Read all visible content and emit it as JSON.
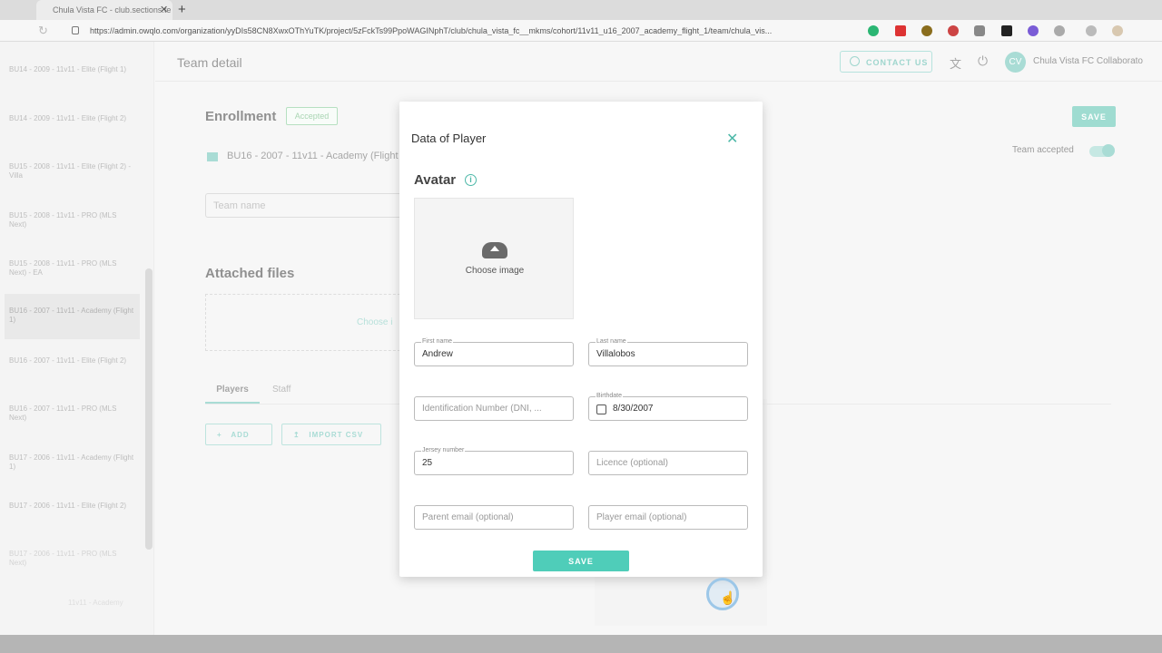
{
  "browser": {
    "tab_title": "Chula Vista FC - club.sections.te",
    "tab_close": "✕",
    "tab_new": "+",
    "url": "https://admin.owqlo.com/organization/yyDIs58CN8XwxOThYuTK/project/5zFckTs99PpoWAGINphT/club/chula_vista_fc__mkms/cohort/11v11_u16_2007_academy_flight_1/team/chula_vis..."
  },
  "sidebar": {
    "items": [
      {
        "label": "BU14 - 2009 - 11v11 - Elite (Flight 1)"
      },
      {
        "label": "BU14 - 2009 - 11v11 - Elite (Flight 2)"
      },
      {
        "label": "BU15 - 2008 - 11v11 - Elite (Flight 2) - Villa"
      },
      {
        "label": "BU15 - 2008 - 11v11 - PRO (MLS Next)"
      },
      {
        "label": "BU15 - 2008 - 11v11 - PRO (MLS Next) - EA"
      },
      {
        "label": "BU16 - 2007 - 11v11 - Academy (Flight 1)"
      },
      {
        "label": "BU16 - 2007 - 11v11 - Elite (Flight 2)"
      },
      {
        "label": "BU16 - 2007 - 11v11 - PRO (MLS Next)"
      },
      {
        "label": "BU17 - 2006 - 11v11 - Academy (Flight 1)"
      },
      {
        "label": "BU17 - 2006 - 11v11 - Elite (Flight 2)"
      },
      {
        "label": "BU17 - 2006 - 11v11 - PRO (MLS Next)"
      },
      {
        "label": "11v11 - Academy"
      }
    ]
  },
  "header": {
    "title": "Team detail",
    "contact_label": "CONTACT US",
    "avatar_initials": "CV",
    "club_name": "Chula Vista FC Collaborato"
  },
  "main": {
    "enrollment_title": "Enrollment",
    "status_badge": "Accepted",
    "team_label": "BU16 - 2007 - 11v11 - Academy (Flight 1",
    "team_name_placeholder": "Team name",
    "attached_title": "Attached files",
    "dropzone_text": "Choose i",
    "tabs": [
      {
        "label": "Players"
      },
      {
        "label": "Staff"
      }
    ],
    "add_label": "ADD",
    "import_label": "IMPORT CSV",
    "save_label": "SAVE",
    "team_accepted_label": "Team accepted",
    "team_accepted": true
  },
  "modal": {
    "title": "Data of Player",
    "avatar_title": "Avatar",
    "choose_image": "Choose image",
    "first_name": {
      "label": "First name",
      "value": "Andrew"
    },
    "last_name": {
      "label": "Last name",
      "value": "Villalobos"
    },
    "id_number": {
      "placeholder": "Identification Number (DNI, ..."
    },
    "birthdate": {
      "label": "Birthdate",
      "value": "8/30/2007"
    },
    "jersey": {
      "label": "Jersey number",
      "value": "25"
    },
    "licence": {
      "placeholder": "Licence (optional)"
    },
    "parent_email": {
      "placeholder": "Parent email (optional)"
    },
    "player_email": {
      "placeholder": "Player email (optional)"
    },
    "save_label": "SAVE"
  },
  "colors": {
    "accent": "#4fcdb9",
    "accent_text": "#4db8a8",
    "badge_green": "#7bbf8b"
  }
}
